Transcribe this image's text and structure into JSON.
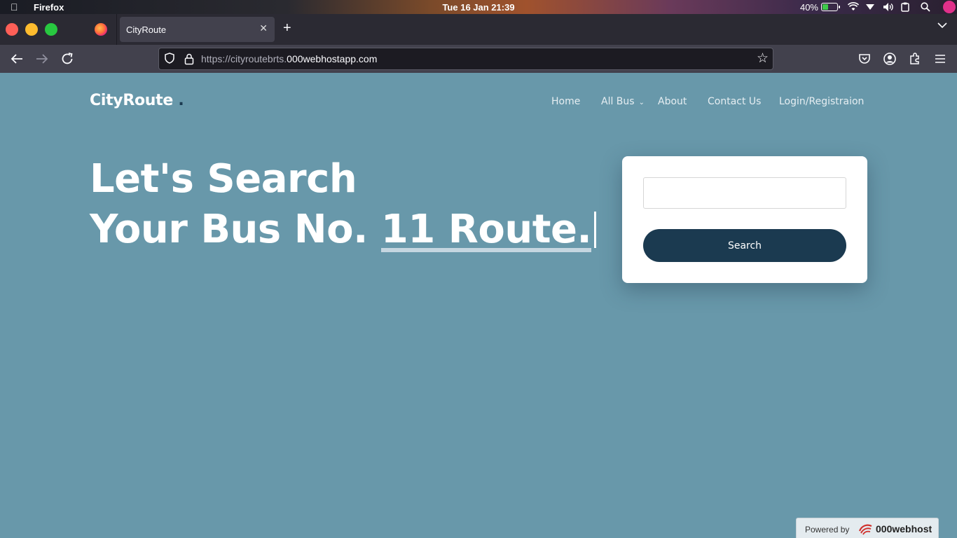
{
  "menubar": {
    "app_name": "Firefox",
    "clock": "Tue 16 Jan 21:39",
    "battery_percent": "40%",
    "battery_level": 0.4
  },
  "browser": {
    "tab_title": "CityRoute",
    "url_prefix": "https://cityroutebrts.",
    "url_domain": "000webhostapp.com"
  },
  "site": {
    "brand": "CityRoute",
    "brand_dot": ".",
    "nav": {
      "home": "Home",
      "all_bus": "All Bus",
      "about": "About",
      "contact": "Contact Us",
      "login": "Login/Registraion"
    },
    "hero": {
      "line1": "Let's Search",
      "line2_prefix": "Your Bus No. ",
      "line2_typed": "11 Route."
    },
    "search": {
      "input_value": "",
      "button_label": "Search"
    },
    "powered": {
      "label": "Powered by",
      "brand": "000webhost"
    }
  },
  "colors": {
    "page_bg": "#6898aa",
    "accent_dark": "#1b3a50",
    "white": "#ffffff"
  }
}
